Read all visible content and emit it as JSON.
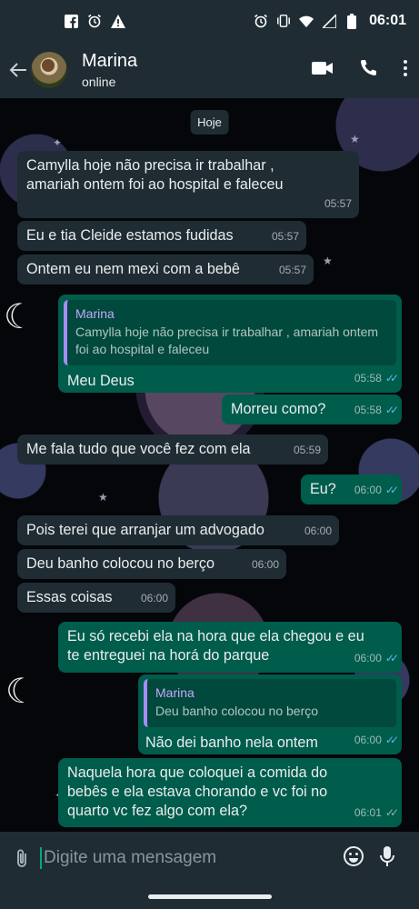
{
  "status_bar": {
    "time": "06:01",
    "left_icons": [
      "facebook-icon",
      "alarm-icon",
      "warning-icon"
    ],
    "right_icons": [
      "alarm-icon",
      "vibrate-icon",
      "wifi-icon",
      "signal-icon",
      "battery-icon"
    ]
  },
  "header": {
    "contact_name": "Marina",
    "contact_status": "online",
    "actions": [
      "video-call-icon",
      "voice-call-icon",
      "more-options-icon"
    ]
  },
  "chat": {
    "date_chip": "Hoje",
    "messages": [
      {
        "dir": "in",
        "text": "Camylla hoje não precisa ir trabalhar ,\namariah ontem foi ao hospital e faleceu",
        "time": "05:57"
      },
      {
        "dir": "in",
        "text": "Eu e tia Cleide estamos fudidas",
        "time": "05:57"
      },
      {
        "dir": "in",
        "text": "Ontem eu nem mexi com a bebê",
        "time": "05:57"
      },
      {
        "dir": "out",
        "quote_name": "Marina",
        "quote_text": "Camylla hoje não precisa ir trabalhar , amariah ontem foi ao hospital e faleceu",
        "text": "Meu Deus",
        "time": "05:58",
        "read": true
      },
      {
        "dir": "out",
        "text": "Morreu como?",
        "time": "05:58",
        "read": true
      },
      {
        "dir": "in",
        "text": "Me fala tudo que você fez com ela",
        "time": "05:59"
      },
      {
        "dir": "out",
        "text": "Eu?",
        "time": "06:00",
        "read": true
      },
      {
        "dir": "in",
        "text": "Pois terei que arranjar um advogado",
        "time": "06:00"
      },
      {
        "dir": "in",
        "text": "Deu banho colocou no berço",
        "time": "06:00"
      },
      {
        "dir": "in",
        "text": "Essas coisas",
        "time": "06:00"
      },
      {
        "dir": "out",
        "text": "Eu só recebi ela na hora que ela chegou e eu\nte entreguei na horá do parque",
        "time": "06:00",
        "read": true
      },
      {
        "dir": "out",
        "quote_name": "Marina",
        "quote_text": "Deu banho colocou no berço",
        "text": "Não dei banho nela ontem",
        "time": "06:00",
        "read": true
      },
      {
        "dir": "out",
        "text": "Naquela hora que coloquei a comida do\nbebês e ela estava chorando e vc foi no\nquarto vc fez algo com ela?",
        "time": "06:01",
        "read": false
      }
    ]
  },
  "input": {
    "placeholder": "Digite uma mensagem"
  },
  "colors": {
    "header_bg": "#1f2c34",
    "incoming_bubble": "#1f2c34",
    "outgoing_bubble": "#005c4b",
    "read_ticks": "#53bdeb",
    "quote_accent": "#a78bfa"
  }
}
